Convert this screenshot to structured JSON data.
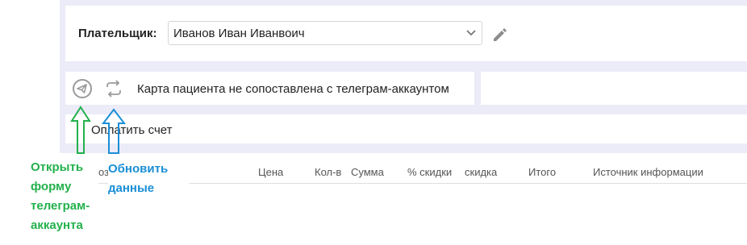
{
  "payer": {
    "label": "Плательщик:",
    "selected": "Иванов Иван Иванвоич"
  },
  "telegram": {
    "status_text": "Карта пациента не сопоставлена с телеграм-аккаунтом"
  },
  "invoice": {
    "pay_button_label": "Оплатить счет"
  },
  "table": {
    "partial_header": "оз",
    "columns": [
      "Цена",
      "Кол-в",
      "Сумма",
      "% скидки",
      "скидка",
      "Итого",
      "Источник информации"
    ]
  },
  "annotations": {
    "open_telegram": "Открыть форму телеграм-аккаунта",
    "refresh": "Обновить данные"
  },
  "colors": {
    "background": "#ecebf8",
    "annotation_green": "#22b14c",
    "annotation_blue": "#1a8fd6",
    "icon_gray": "#9a9a9a"
  },
  "icons": {
    "telegram": "telegram-icon",
    "refresh": "refresh-icon",
    "edit": "pencil-icon",
    "dropdown": "chevron-down-icon"
  }
}
